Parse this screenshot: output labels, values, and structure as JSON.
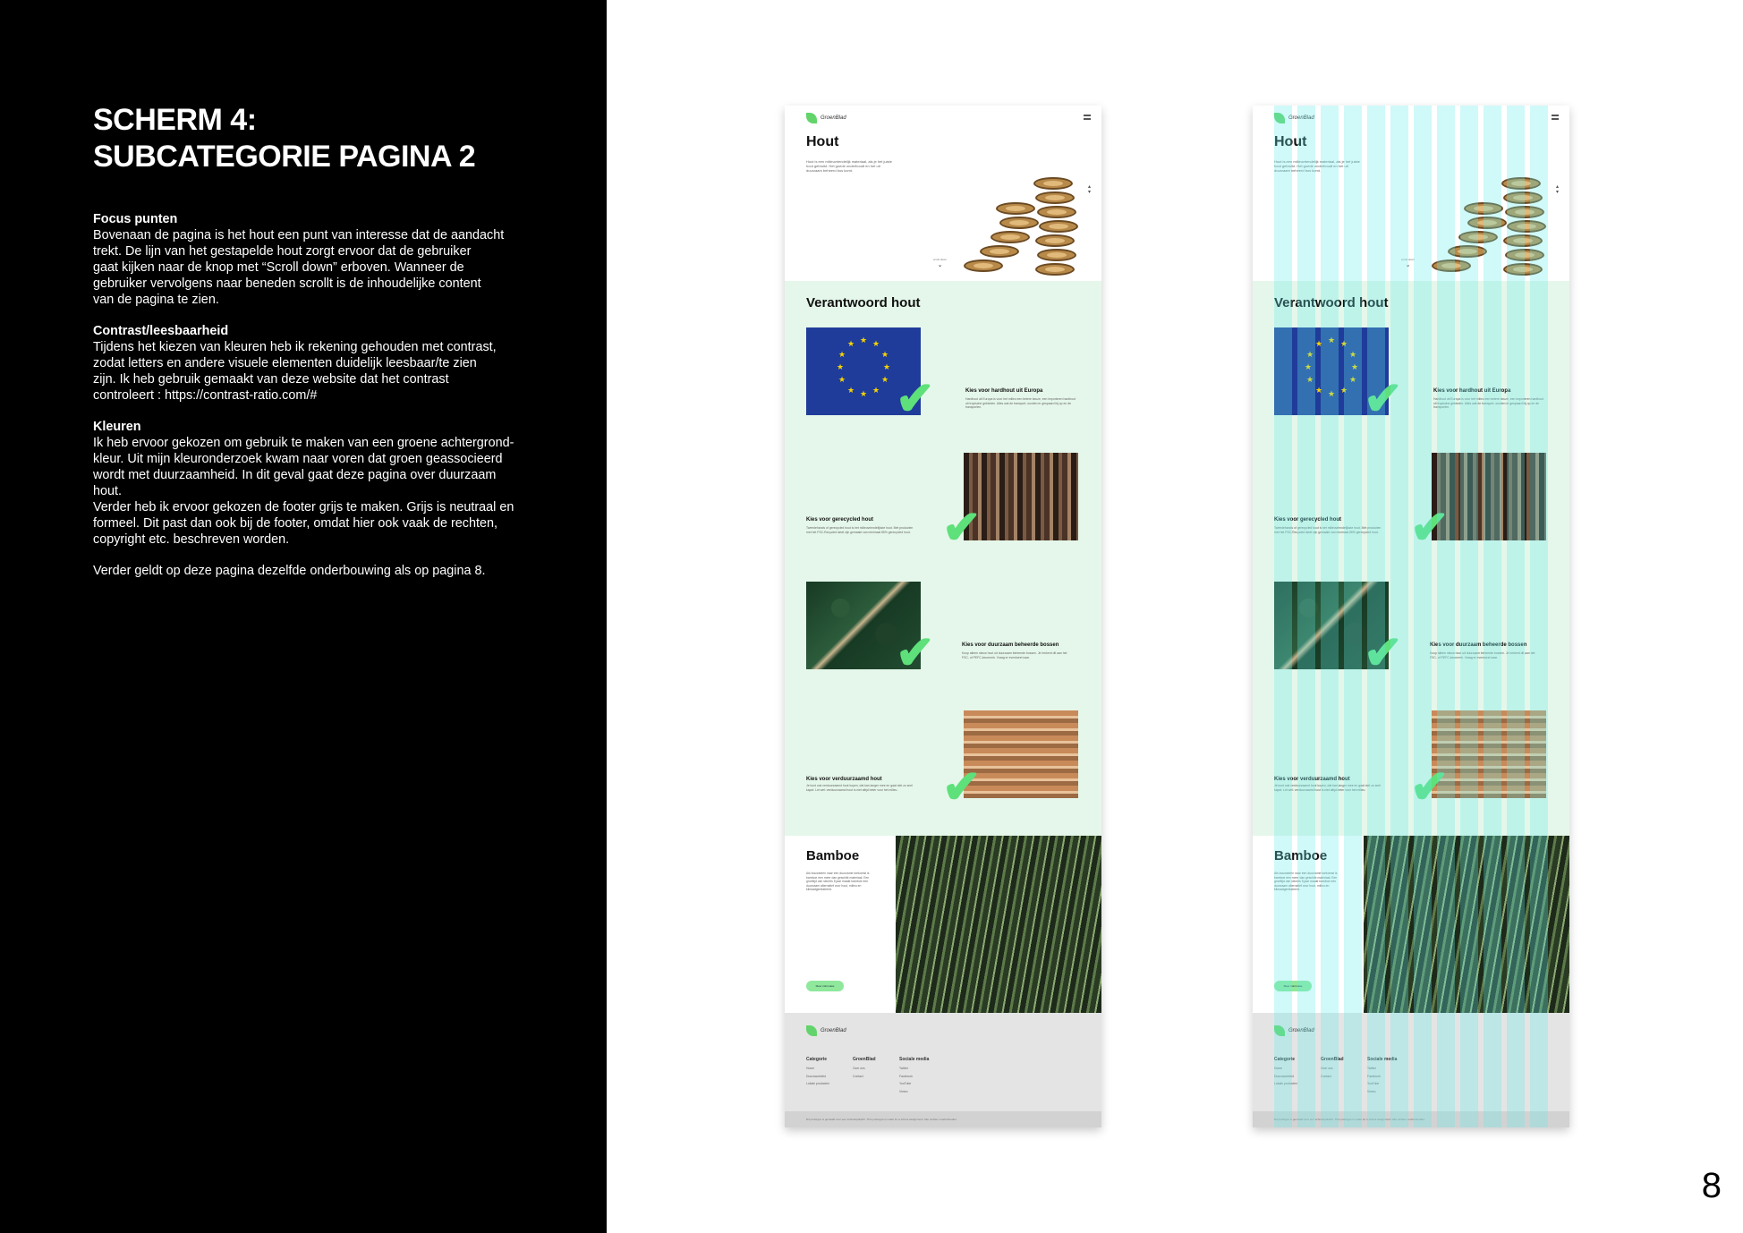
{
  "left": {
    "heading_line1": "SCHERM 4:",
    "heading_line2": "SUBCATEGORIE PAGINA 2",
    "section1_title": "Focus punten",
    "section1_lines": [
      "Bovenaan de pagina is het hout een punt van interesse dat de aandacht",
      "trekt. De lijn van het gestapelde hout zorgt ervoor dat de gebruiker",
      "gaat kijken naar de knop met “Scroll down” erboven. Wanneer de",
      "gebruiker vervolgens naar beneden scrollt is de inhoudelijke content",
      "van de pagina te zien."
    ],
    "section2_title": "Contrast/leesbaarheid",
    "section2_lines": [
      "Tijdens het kiezen van kleuren heb ik rekening gehouden met contrast,",
      "zodat letters en andere visuele elementen duidelijk leesbaar/te zien",
      "zijn. Ik heb gebruik gemaakt van deze website dat het contrast",
      "controleert : https://contrast-ratio.com/#"
    ],
    "section3_title": "Kleuren",
    "section3_lines": [
      "Ik heb ervoor gekozen om gebruik te maken van een groene achtergrond-",
      "kleur. Uit mijn kleuronderzoek kwam naar voren dat groen geassocieerd",
      "wordt met duurzaamheid. In dit geval gaat deze pagina over duurzaam",
      "hout.",
      "Verder heb ik ervoor gekozen de footer grijs te maken. Grijs is neutraal en",
      "formeel. Dit past dan ook bij de footer, omdat hier ook vaak de rechten,",
      "copyright etc. beschreven worden."
    ],
    "closing": "Verder geldt op deze pagina dezelfde onderbouwing als op pagina 8."
  },
  "page_number": "8",
  "mockup": {
    "logo": "GroenBlad",
    "title": "Hout",
    "intro": "Hout is een milieuvriendelijk materiaal, als je het juiste hout gebruikt. Het goede onderhoudt en het uit duurzaam beheerd bos komt.",
    "scroll_label": "scroll down",
    "section_title": "Verantwoord hout",
    "features": [
      {
        "title": "Kies voor hardhout uit Europa",
        "desc": "Hardhout uit Europa is voor het milieu een betere keuze, een importeren hardhout uit tropische gebieden. Alles wat de transport, worden er gespaard bij op en de transporten."
      },
      {
        "title": "Kies voor gerecycled hout",
        "desc": "Tweedehands of gerecycled hout is het milieuvriendelijkste hout. Met producten met het FSC-Recycled label zijn gemaakt van minimaal 85% gerecycled hout."
      },
      {
        "title": "Kies voor duurzaam beheerde bossen",
        "desc": "Koop alleen nieuw hout uit duurzaam beheerde bossen. Je herkent dit aan het FSC- of PEFC-keurmerk. Vraag er eventueel naar."
      },
      {
        "title": "Kies voor verduurzaamd hout",
        "desc": "Je kunt ook verduurzaamd hout kopen, dat kan langer mee en gaat niet zo snel kapot. Let wel: verduurzaamd hout is niet altijd beter voor het milieu."
      }
    ],
    "bamboo_title": "Bamboe",
    "bamboo_desc": "Als bouwsteen naar een duurzame toekomst is bamboe een meer dan geschikt materiaal. Een groeitijd van slechts 5 jaar maakt bamboe een duurzaam alternatief voor hout, milieu en klimaatgerelateerd.",
    "bamboo_button": "Meer informatie",
    "footer": {
      "logo": "GroenBlad",
      "col1_title": "Categorie",
      "col1_items": [
        "Home",
        "Duurzaamheid",
        "Lokale producten"
      ],
      "col2_title": "GroenBlad",
      "col2_items": [
        "Over ons",
        "Contact"
      ],
      "col3_title": "Sociale media",
      "col3_items": [
        "Twitter",
        "Facebook",
        "YouTube",
        "Vimeo"
      ],
      "bottom": "Dit prototype is gemaakt voor een schoolopdracht. This prototype is made for a school assignment. Alle rechten voorbehouden."
    }
  },
  "colors": {
    "green_bg": "#e5f7ea",
    "check": "#5ee07a",
    "button": "#8fe89c",
    "footer": "#e4e4e4",
    "grid_overlay": "#64ebeb"
  }
}
